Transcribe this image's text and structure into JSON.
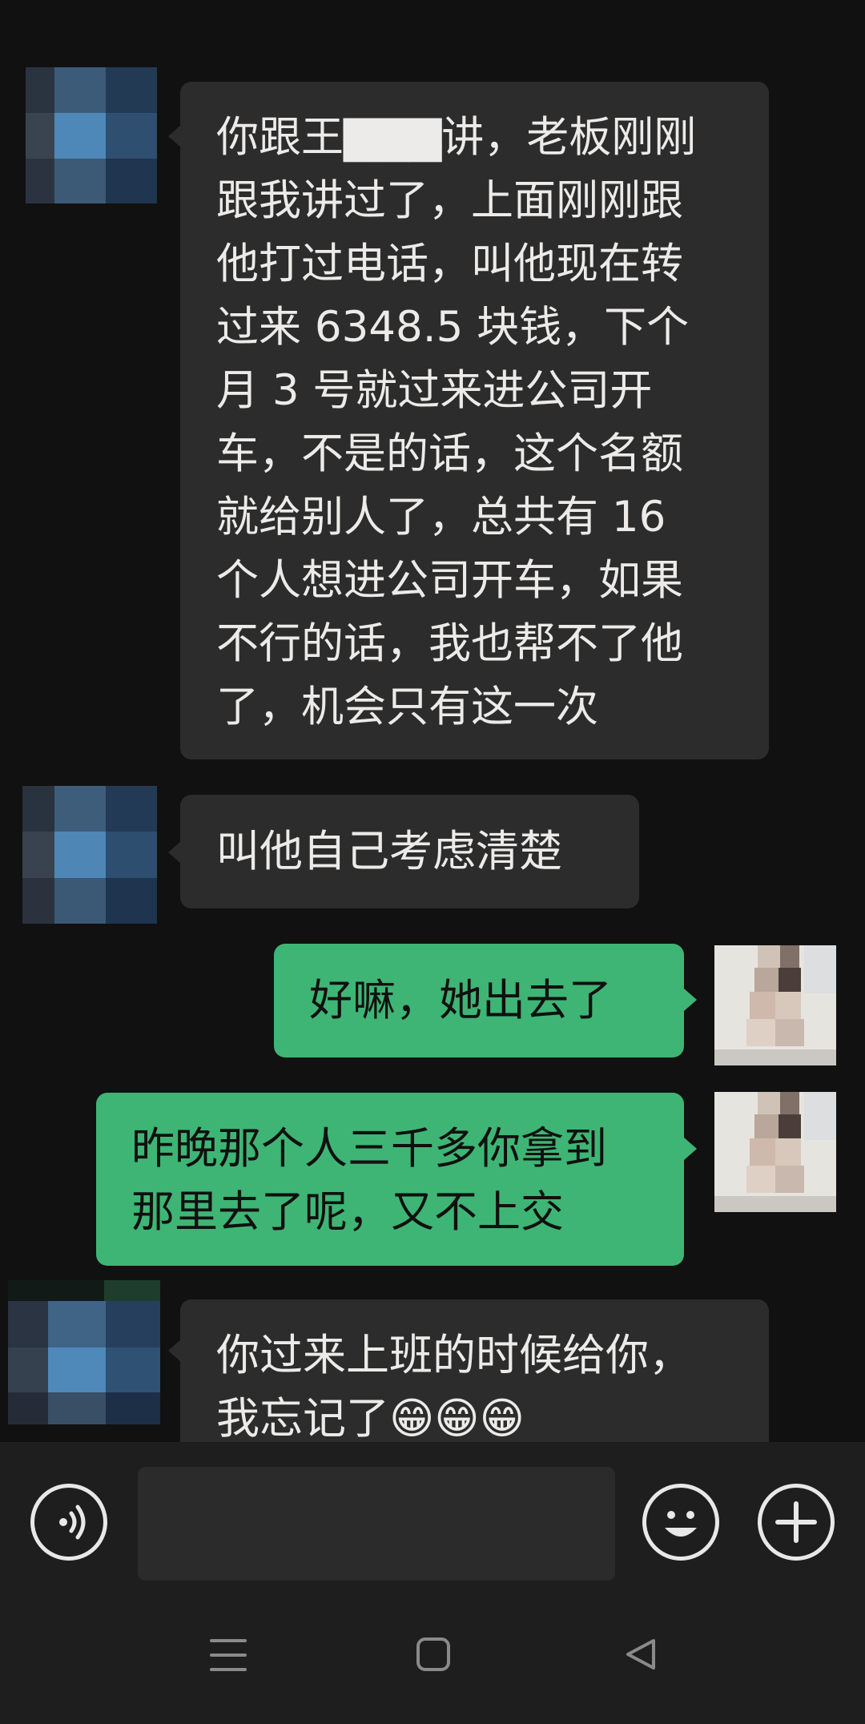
{
  "messages": [
    {
      "side": "incoming",
      "text": "你跟王▇▇▇讲，老板刚刚\n跟我讲过了，上面刚刚跟\n他打过电话，叫他现在转\n过来 6348.5 块钱，下个\n月 3 号就过来进公司开\n车，不是的话，这个名额\n就给别人了，总共有 16\n个人想进公司开车，如果\n不行的话，我也帮不了他\n了，机会只有这一次"
    },
    {
      "side": "incoming",
      "text": "叫他自己考虑清楚"
    },
    {
      "side": "outgoing",
      "text": "好嘛，她出去了"
    },
    {
      "side": "outgoing",
      "text": "昨晚那个人三千多你拿到\n那里去了呢，又不上交"
    },
    {
      "side": "incoming",
      "text": "你过来上班的时候给你，\n我忘记了😁😁😁"
    }
  ],
  "input_bar": {
    "voice_icon": "voice-wave-icon",
    "emoji_icon": "smiley-face-icon",
    "plus_icon": "plus-icon",
    "input_value": ""
  },
  "nav_bar": {
    "menu_icon": "menu-icon",
    "home_icon": "home-square-icon",
    "back_icon": "back-triangle-icon"
  },
  "colors": {
    "background": "#111111",
    "incoming_bubble": "#2c2c2c",
    "outgoing_bubble": "#3eb575",
    "bar": "#1e1e1e"
  }
}
